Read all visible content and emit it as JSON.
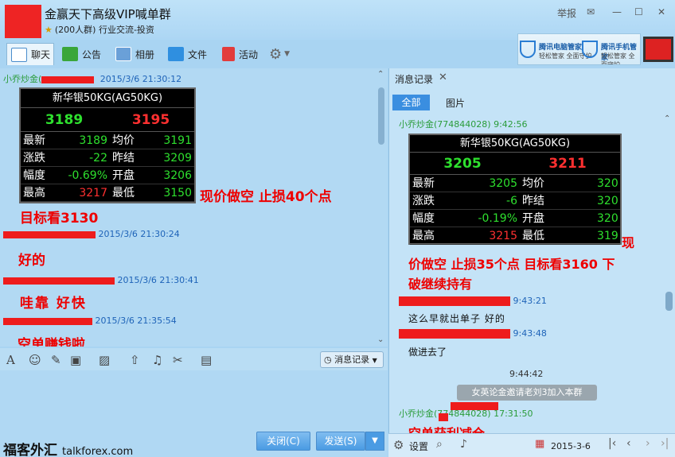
{
  "window": {
    "group_name": "金赢天下高级VIP喊单群",
    "group_sub": "(200人群) 行业交流-投资",
    "report_label": "举报",
    "minimize_symbol": "—",
    "maximize_symbol": "☐",
    "close_symbol": "✕",
    "accent_color": "#ee2424"
  },
  "toolbar": {
    "chat": "聊天",
    "notice": "公告",
    "album": "相册",
    "files": "文件",
    "activity": "活动",
    "settings_icon": "gear-icon"
  },
  "ad": {
    "left_title": "腾讯电脑管家",
    "left_sub": "轻松管家 全面守护",
    "right_title": "腾讯手机管家",
    "right_sub": "轻松管家 全面守护"
  },
  "chat": {
    "msg1": {
      "sender_prefix": "小乔炒金(",
      "time": "2015/3/6 21:30:12",
      "quote": {
        "title": "新华银50KG(AG50KG)",
        "bid": "3189",
        "ask": "3195",
        "rows": [
          {
            "l1": "最新",
            "v1": "3189",
            "l2": "均价",
            "v2": "3191"
          },
          {
            "l1": "涨跌",
            "v1": "-22",
            "l2": "昨结",
            "v2": "3209"
          },
          {
            "l1": "幅度",
            "v1": "-0.69%",
            "l2": "开盘",
            "v2": "3206"
          },
          {
            "l1": "最高",
            "v1": "3217",
            "l2": "最低",
            "v2": "3150"
          }
        ]
      },
      "text_line1": "现价做空    止损40个点",
      "text_line2": "目标看3130"
    },
    "msg2": {
      "time": "2015/3/6 21:30:24",
      "text": "好的"
    },
    "msg3": {
      "time": "2015/3/6 21:30:41",
      "text": "哇靠  好快"
    },
    "msg4": {
      "time": "2015/3/6 21:35:54",
      "text": "空单赚钱啦"
    }
  },
  "input": {
    "history_label": "消息记录",
    "close_label": "关闭(C)",
    "send_label": "发送(S)"
  },
  "watermark": {
    "brand": "福客外汇",
    "site": "talkforex.com"
  },
  "right": {
    "tab_label": "消息记录",
    "filter_all": "全部",
    "filter_images": "图片",
    "msg1": {
      "sender": "小乔炒金(774844028) 9:42:56",
      "quote": {
        "title": "新华银50KG(AG50KG)",
        "bid": "3205",
        "ask": "3211",
        "rows": [
          {
            "l1": "最新",
            "v1": "3205",
            "l2": "均价",
            "v2": "320"
          },
          {
            "l1": "涨跌",
            "v1": "-6",
            "l2": "昨结",
            "v2": "320"
          },
          {
            "l1": "幅度",
            "v1": "-0.19%",
            "l2": "开盘",
            "v2": "320"
          },
          {
            "l1": "最高",
            "v1": "3215",
            "l2": "最低",
            "v2": "319"
          }
        ]
      },
      "text_tail": "现",
      "text_line2": "价做空 止损35个点 目标看3160 下",
      "text_line3": "破继续持有"
    },
    "msg2": {
      "time": "9:43:21",
      "text": "这么早就出单子   好的"
    },
    "msg3": {
      "time": "9:43:48",
      "text": "做进去了"
    },
    "notice_time": "9:44:42",
    "notice_text": "女英论金邀请老刘3加入本群",
    "msg4": {
      "sender": "小乔炒金(774844028) 17:31:50",
      "text": "空单获利减仓"
    },
    "bottom": {
      "settings": "设置",
      "date": "2015-3-6"
    }
  }
}
